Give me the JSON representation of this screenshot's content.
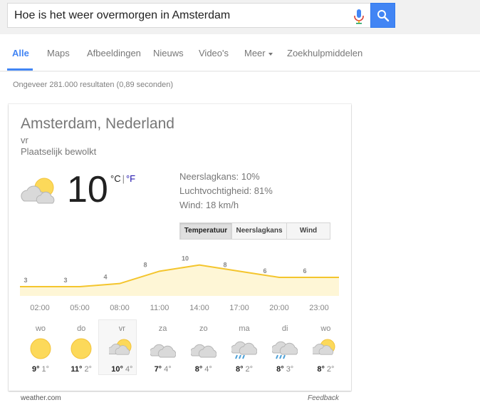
{
  "search": {
    "query": "Hoe is het weer overmorgen in Amsterdam"
  },
  "tabs": [
    {
      "label": "Alle",
      "active": true
    },
    {
      "label": "Maps"
    },
    {
      "label": "Afbeeldingen"
    },
    {
      "label": "Nieuws"
    },
    {
      "label": "Video's"
    },
    {
      "label": "Meer"
    },
    {
      "label": "Zoekhulpmiddelen"
    }
  ],
  "stats": "Ongeveer 281.000 resultaten (0,89 seconden)",
  "weather": {
    "location": "Amsterdam, Nederland",
    "day": "vr",
    "condition": "Plaatselijk bewolkt",
    "temperature": "10",
    "unit_c": "°C",
    "unit_sep": "|",
    "unit_f": "°F",
    "current_icon": "partly-cloudy-icon",
    "details": {
      "precipitation": "Neerslagkans: 10%",
      "humidity": "Luchtvochtigheid: 81%",
      "wind": "Wind: 18 km/h"
    },
    "toggles": [
      "Temperatuur",
      "Neerslagkans",
      "Wind"
    ],
    "active_toggle": "Temperatuur",
    "forecast": [
      {
        "day": "wo",
        "hi": "9°",
        "lo": "1°",
        "icon": "sunny-icon"
      },
      {
        "day": "do",
        "hi": "11°",
        "lo": "2°",
        "icon": "sunny-icon"
      },
      {
        "day": "vr",
        "hi": "10°",
        "lo": "4°",
        "icon": "partly-cloudy-icon",
        "selected": true
      },
      {
        "day": "za",
        "hi": "7°",
        "lo": "4°",
        "icon": "cloudy-icon"
      },
      {
        "day": "zo",
        "hi": "8°",
        "lo": "4°",
        "icon": "cloudy-icon"
      },
      {
        "day": "ma",
        "hi": "8°",
        "lo": "2°",
        "icon": "rain-icon"
      },
      {
        "day": "di",
        "hi": "8°",
        "lo": "3°",
        "icon": "rain-icon"
      },
      {
        "day": "wo",
        "hi": "8°",
        "lo": "2°",
        "icon": "partly-cloudy-icon"
      }
    ],
    "source": "weather.com",
    "feedback": "Feedback",
    "colors": {
      "sun": "#fcd95a",
      "sun_edge": "#f3c33b",
      "cloud": "#d9d9d9",
      "cloud_edge": "#b5b5b5",
      "rain": "#4a9fd6",
      "line": "#f4c52d",
      "fill": "#fef6d6"
    }
  },
  "chart_data": {
    "type": "area",
    "categories": [
      "02:00",
      "05:00",
      "08:00",
      "11:00",
      "14:00",
      "17:00",
      "20:00",
      "23:00"
    ],
    "values": [
      3,
      3,
      4,
      8,
      10,
      8,
      6,
      6
    ],
    "data_labels": [
      "3",
      "3",
      "4",
      "8",
      "10",
      "8",
      "6",
      "6"
    ],
    "title": "",
    "xlabel": "",
    "ylabel": "",
    "ylim": [
      0,
      12
    ],
    "grid": false,
    "legend": "none"
  }
}
